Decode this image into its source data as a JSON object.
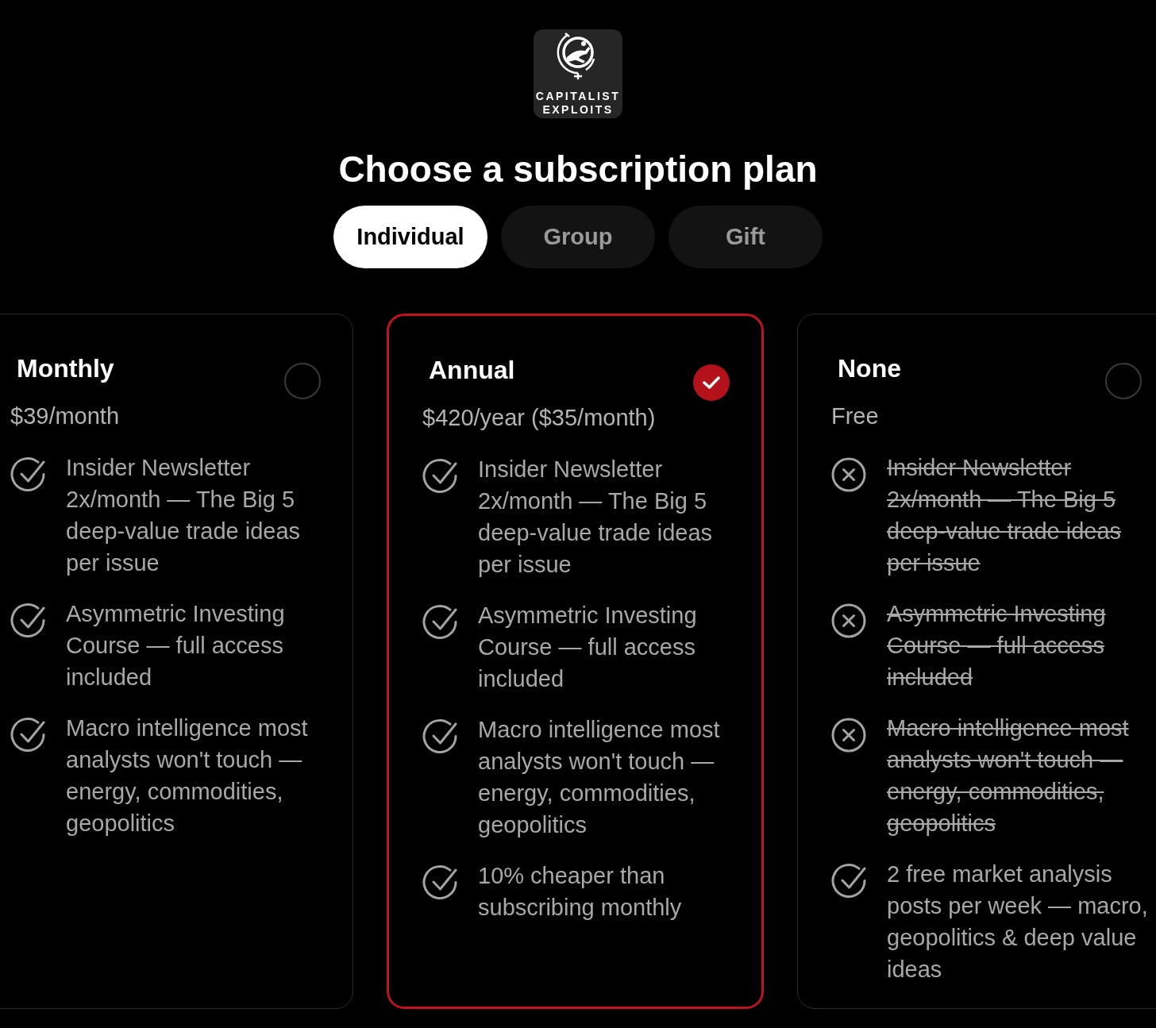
{
  "logo": {
    "lines": [
      "CAPITALIST",
      "EXPLOITS"
    ]
  },
  "title": "Choose a subscription plan",
  "tabs": [
    {
      "label": "Individual",
      "selected": true
    },
    {
      "label": "Group",
      "selected": false
    },
    {
      "label": "Gift",
      "selected": false
    }
  ],
  "plans": [
    {
      "name": "Monthly",
      "price": "$39/month",
      "selected": false,
      "features": [
        {
          "text": "Insider Newsletter 2x/month — The Big 5 deep-value trade ideas per issue",
          "included": true
        },
        {
          "text": "Asymmetric Investing Course — full access included",
          "included": true
        },
        {
          "text": "Macro intelligence most analysts won't touch — energy, commodities, geopolitics",
          "included": true
        }
      ]
    },
    {
      "name": "Annual",
      "price": "$420/year ($35/month)",
      "selected": true,
      "features": [
        {
          "text": "Insider Newsletter 2x/month — The Big 5 deep-value trade ideas per issue",
          "included": true
        },
        {
          "text": "Asymmetric Investing Course — full access included",
          "included": true
        },
        {
          "text": "Macro intelligence most analysts won't touch — energy, commodities, geopolitics",
          "included": true
        },
        {
          "text": "10% cheaper than subscribing monthly",
          "included": true
        }
      ]
    },
    {
      "name": "None",
      "price": "Free",
      "selected": false,
      "features": [
        {
          "text": "Insider Newsletter 2x/month — The Big 5 deep-value trade ideas per issue",
          "included": false
        },
        {
          "text": "Asymmetric Investing Course — full access included",
          "included": false
        },
        {
          "text": "Macro intelligence most analysts won't touch — energy, commodities, geopolitics",
          "included": false
        },
        {
          "text": "2 free market analysis posts per week — macro, geopolitics & deep value ideas",
          "included": true
        }
      ]
    }
  ]
}
